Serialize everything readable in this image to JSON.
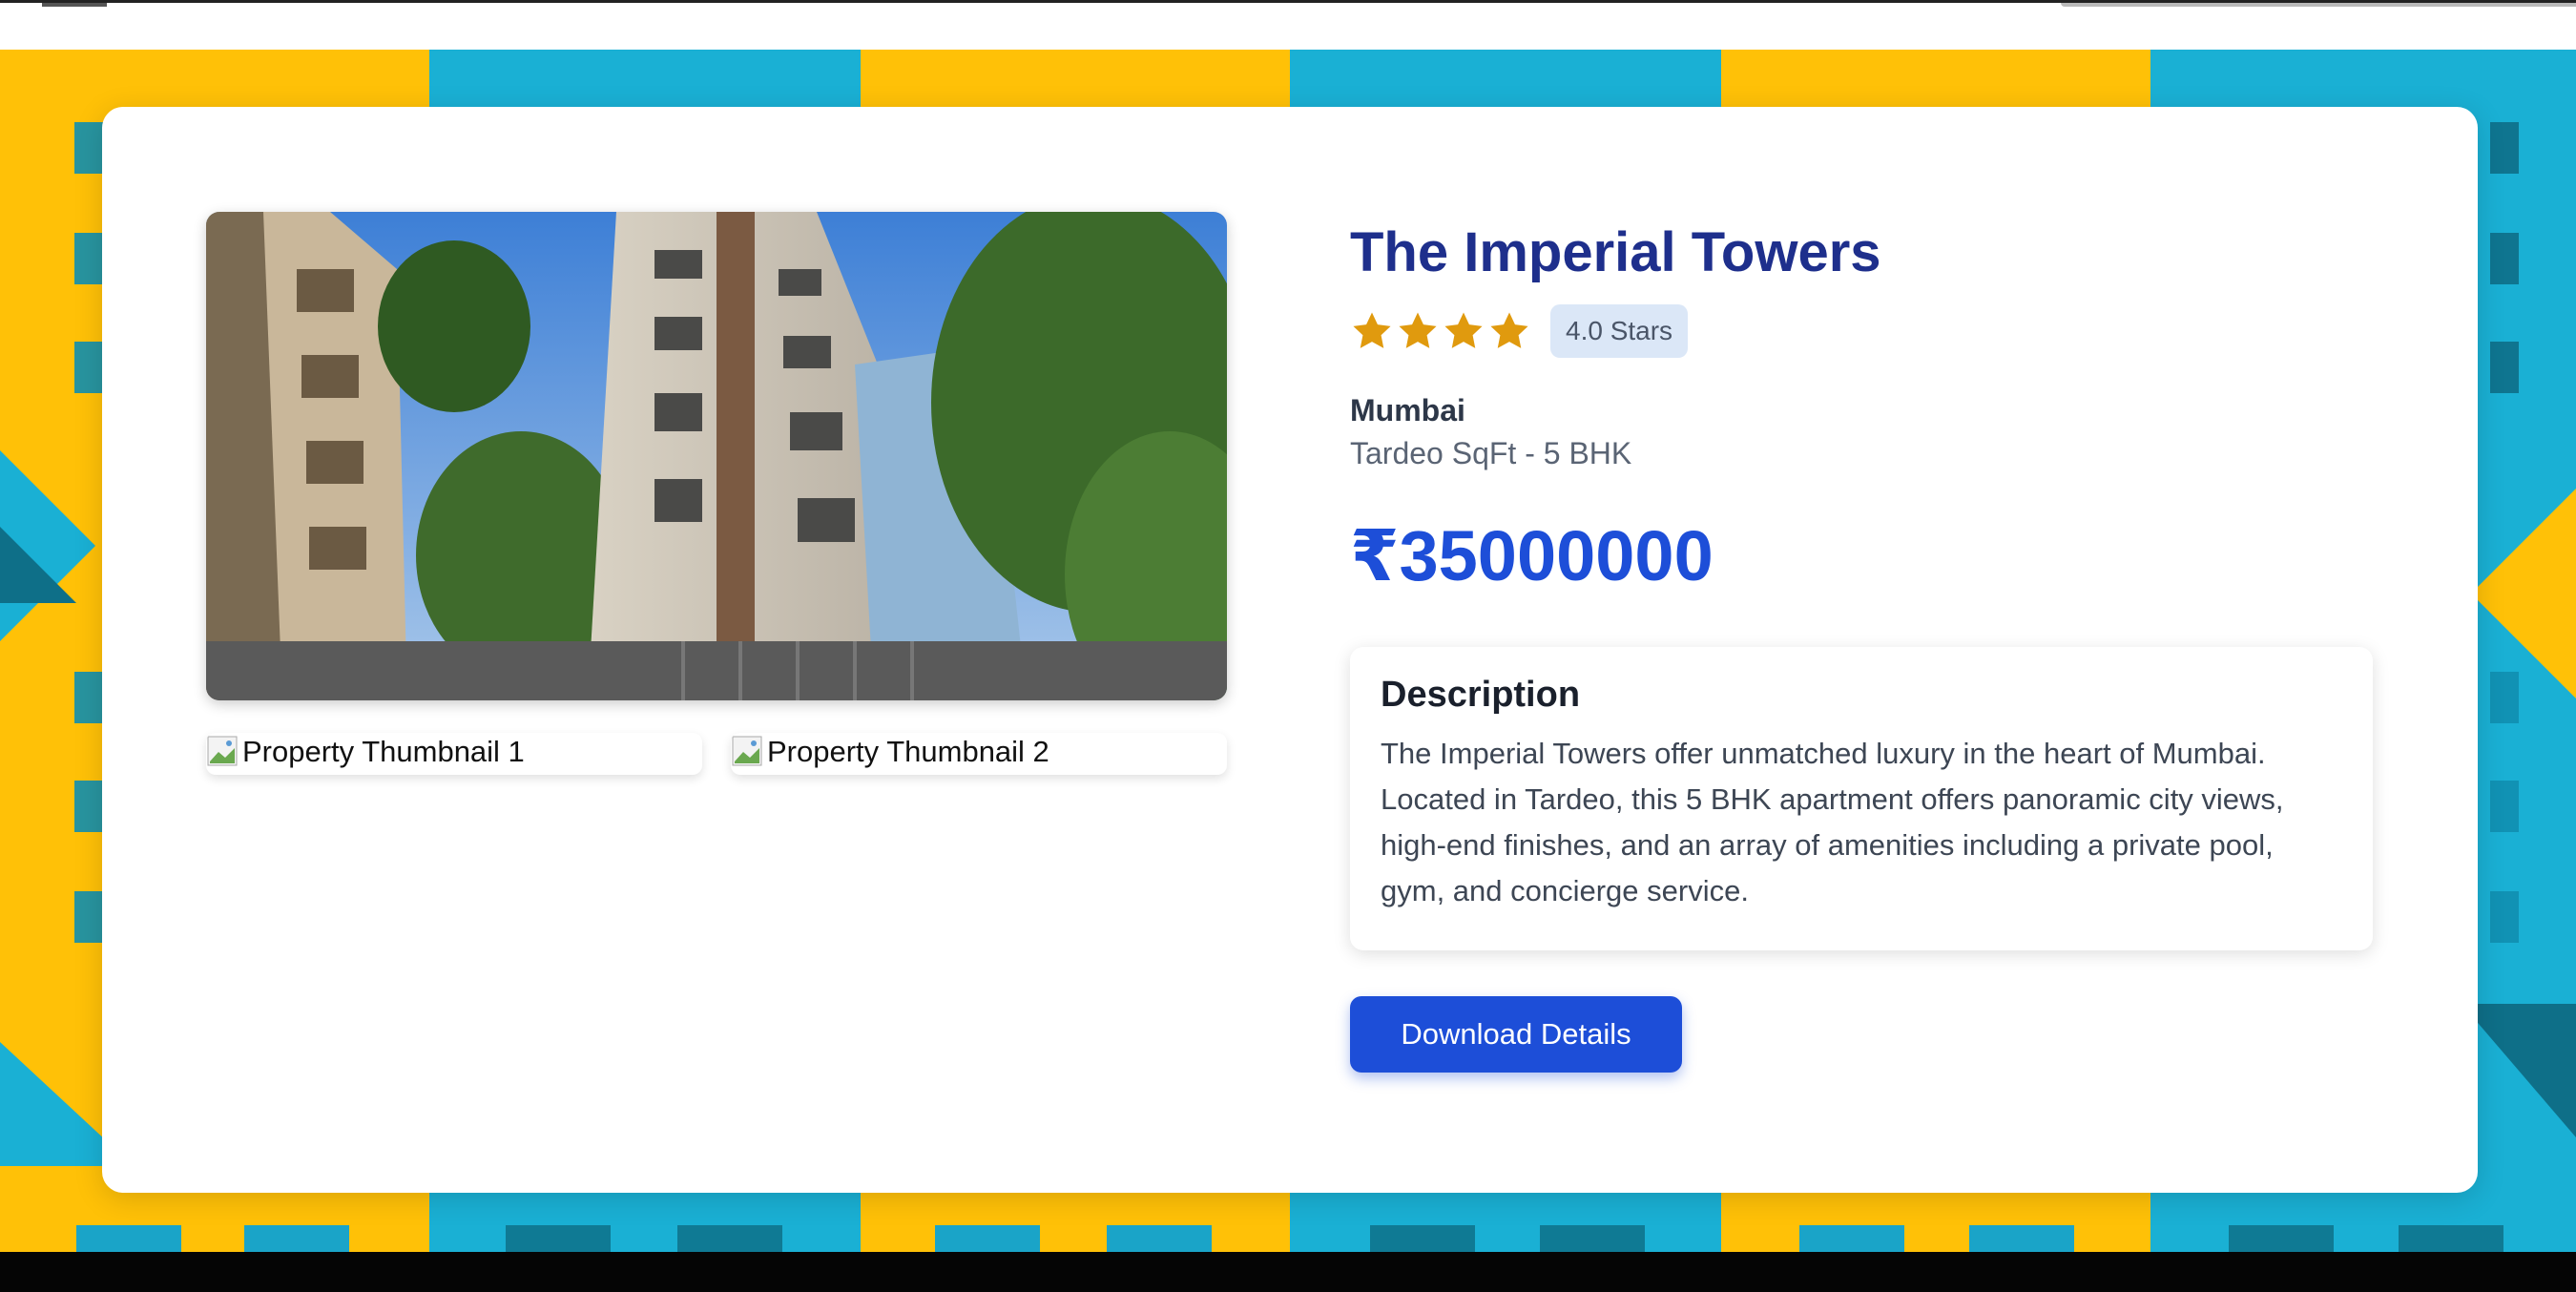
{
  "property": {
    "title": "The Imperial Towers",
    "rating": 4,
    "rating_label": "4.0 Stars",
    "city": "Mumbai",
    "subtitle": "Tardeo SqFt - 5 BHK",
    "price": "₹35000000",
    "description": {
      "heading": "Description",
      "text": "The Imperial Towers offer unmatched luxury in the heart of Mumbai. Located in Tardeo, this 5 BHK apartment offers panoramic city views, high-end finishes, and an array of amenities including a private pool, gym, and concierge service."
    },
    "download_label": "Download Details"
  },
  "gallery": {
    "thumbnails": [
      {
        "alt": "Property Thumbnail 1"
      },
      {
        "alt": "Property Thumbnail 2"
      }
    ]
  },
  "colors": {
    "title": "#1e2f8c",
    "accent": "#1d4ed8",
    "star": "#e09a0e",
    "badge_bg": "#dbe7f7",
    "bg_yellow": "#ffc107",
    "bg_cyan": "#1ab0d4"
  }
}
